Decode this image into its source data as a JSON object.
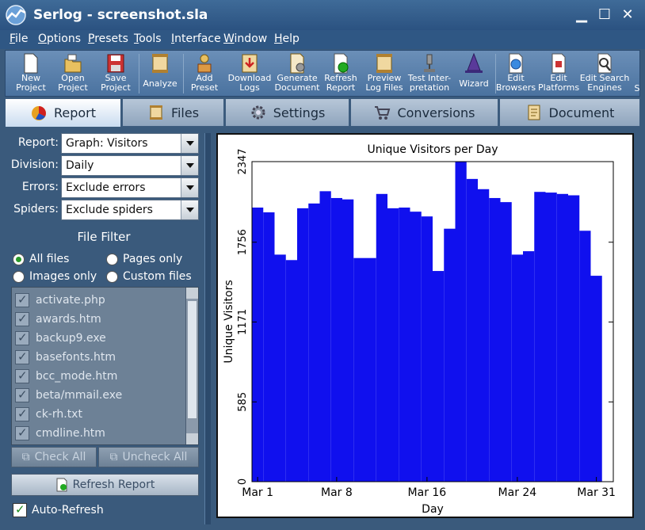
{
  "window": {
    "title": "Serlog - screenshot.sla",
    "minimize": "▁",
    "maximize": "☐",
    "close": "✕"
  },
  "menu": [
    "File",
    "Options",
    "Presets",
    "Tools",
    "Interface",
    "Window",
    "Help"
  ],
  "toolbar": [
    {
      "label": "New\nProject",
      "icon": "new-project-icon"
    },
    {
      "label": "Open\nProject",
      "icon": "open-project-icon"
    },
    {
      "label": "Save\nProject",
      "icon": "save-project-icon"
    },
    {
      "label": "Analyze",
      "icon": "analyze-icon"
    },
    {
      "label": "Add\nPreset",
      "icon": "add-preset-icon"
    },
    {
      "label": "Download\nLogs",
      "icon": "download-logs-icon"
    },
    {
      "label": "Generate\nDocument",
      "icon": "generate-document-icon"
    },
    {
      "label": "Refresh\nReport",
      "icon": "refresh-report-icon"
    },
    {
      "label": "Preview\nLog Files",
      "icon": "preview-logs-icon"
    },
    {
      "label": "Test Inter-\npretation",
      "icon": "test-interpretation-icon"
    },
    {
      "label": "Wizard",
      "icon": "wizard-icon"
    },
    {
      "label": "Edit\nBrowsers",
      "icon": "edit-browsers-icon"
    },
    {
      "label": "Edit\nPlatforms",
      "icon": "edit-platforms-icon"
    },
    {
      "label": "Edit Search\nEngines",
      "icon": "edit-search-engines-icon"
    },
    {
      "label": "S",
      "icon": "overflow-icon"
    }
  ],
  "tabs": [
    {
      "label": "Report",
      "active": true,
      "icon": "pie-chart-icon"
    },
    {
      "label": "Files",
      "active": false,
      "icon": "scroll-icon"
    },
    {
      "label": "Settings",
      "active": false,
      "icon": "gear-icon"
    },
    {
      "label": "Conversions",
      "active": false,
      "icon": "cart-icon"
    },
    {
      "label": "Document",
      "active": false,
      "icon": "document-icon"
    }
  ],
  "filters": [
    {
      "label": "Report:",
      "value": "Graph: Visitors"
    },
    {
      "label": "Division:",
      "value": "Daily"
    },
    {
      "label": "Errors:",
      "value": "Exclude errors"
    },
    {
      "label": "Spiders:",
      "value": "Exclude spiders"
    }
  ],
  "file_filter": {
    "title": "File Filter",
    "options": [
      {
        "label": "All files",
        "selected": true
      },
      {
        "label": "Pages only",
        "selected": false
      },
      {
        "label": "Images only",
        "selected": false
      },
      {
        "label": "Custom files",
        "selected": false
      }
    ],
    "files": [
      "activate.php",
      "awards.htm",
      "backup9.exe",
      "basefonts.htm",
      "bcc_mode.htm",
      "beta/mmail.exe",
      "ck-rh.txt",
      "cmdline.htm"
    ]
  },
  "buttons": {
    "check_all": "Check All",
    "uncheck_all": "Uncheck All",
    "refresh_report": "Refresh Report",
    "auto_refresh": "Auto-Refresh"
  },
  "chart_data": {
    "type": "bar",
    "title": "Unique Visitors per Day",
    "xlabel": "Day",
    "ylabel": "Unique Visitors",
    "yticks": [
      0,
      585,
      1171,
      1756,
      2347
    ],
    "ylim": [
      0,
      2347
    ],
    "xticks": [
      {
        "day": 1,
        "label": "Mar 1"
      },
      {
        "day": 8,
        "label": "Mar 8"
      },
      {
        "day": 16,
        "label": "Mar 16"
      },
      {
        "day": 24,
        "label": "Mar 24"
      },
      {
        "day": 31,
        "label": "Mar 31"
      }
    ],
    "x": [
      1,
      2,
      3,
      4,
      5,
      6,
      7,
      8,
      9,
      10,
      11,
      12,
      13,
      14,
      15,
      16,
      17,
      18,
      19,
      20,
      21,
      22,
      23,
      24,
      25,
      26,
      27,
      28,
      29,
      30,
      31,
      32
    ],
    "values": [
      2010,
      1975,
      1665,
      1625,
      2005,
      2040,
      2130,
      2080,
      2070,
      1640,
      1640,
      2110,
      2005,
      2010,
      1980,
      1945,
      1545,
      1855,
      2347,
      2220,
      2145,
      2080,
      2050,
      1665,
      1690,
      2125,
      2120,
      2110,
      2100,
      1840,
      1510
    ],
    "bar_color": "#1010ee",
    "grid": false
  }
}
